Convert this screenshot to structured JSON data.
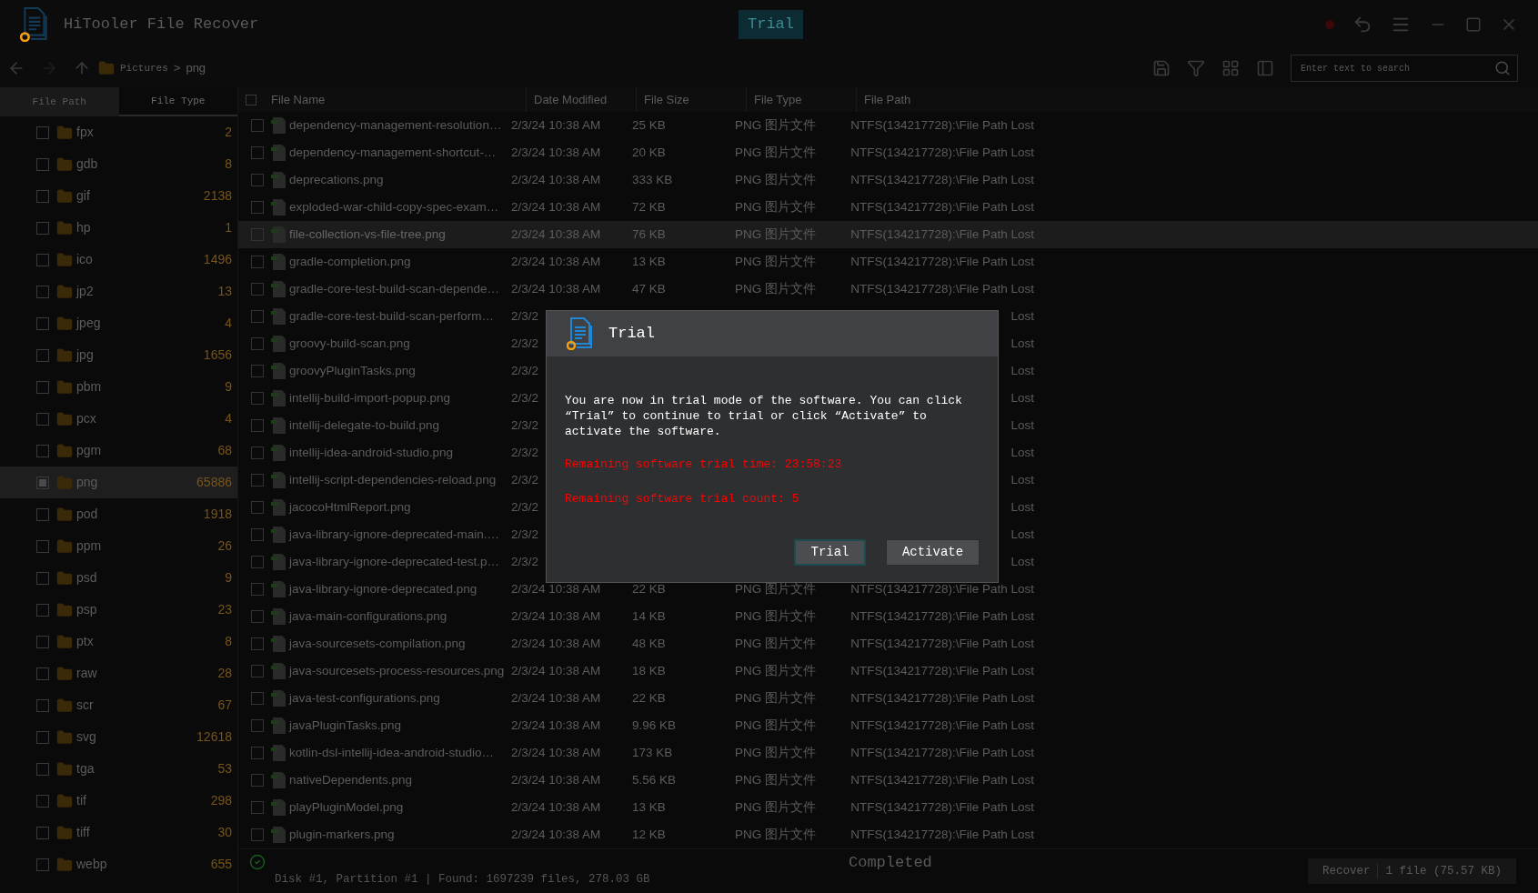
{
  "title_bar": {
    "app_name": "HiTooler File Recover",
    "badge": "Trial"
  },
  "breadcrumb": {
    "items": [
      "Pictures",
      "png"
    ],
    "separator": ">"
  },
  "search": {
    "placeholder": "Enter text to search"
  },
  "sidebar": {
    "tabs": [
      {
        "label": "File Path",
        "selected": false
      },
      {
        "label": "File Type",
        "selected": true
      }
    ],
    "items": [
      {
        "name": "fpx",
        "count": "2",
        "selected": false,
        "checked": false
      },
      {
        "name": "gdb",
        "count": "8",
        "selected": false,
        "checked": false
      },
      {
        "name": "gif",
        "count": "2138",
        "selected": false,
        "checked": false
      },
      {
        "name": "hp",
        "count": "1",
        "selected": false,
        "checked": false
      },
      {
        "name": "ico",
        "count": "1496",
        "selected": false,
        "checked": false
      },
      {
        "name": "jp2",
        "count": "13",
        "selected": false,
        "checked": false
      },
      {
        "name": "jpeg",
        "count": "4",
        "selected": false,
        "checked": false
      },
      {
        "name": "jpg",
        "count": "1656",
        "selected": false,
        "checked": false
      },
      {
        "name": "pbm",
        "count": "9",
        "selected": false,
        "checked": false
      },
      {
        "name": "pcx",
        "count": "4",
        "selected": false,
        "checked": false
      },
      {
        "name": "pgm",
        "count": "68",
        "selected": false,
        "checked": false
      },
      {
        "name": "png",
        "count": "65886",
        "selected": true,
        "checked": true
      },
      {
        "name": "pod",
        "count": "1918",
        "selected": false,
        "checked": false
      },
      {
        "name": "ppm",
        "count": "26",
        "selected": false,
        "checked": false
      },
      {
        "name": "psd",
        "count": "9",
        "selected": false,
        "checked": false
      },
      {
        "name": "psp",
        "count": "23",
        "selected": false,
        "checked": false
      },
      {
        "name": "ptx",
        "count": "8",
        "selected": false,
        "checked": false
      },
      {
        "name": "raw",
        "count": "28",
        "selected": false,
        "checked": false
      },
      {
        "name": "scr",
        "count": "67",
        "selected": false,
        "checked": false
      },
      {
        "name": "svg",
        "count": "12618",
        "selected": false,
        "checked": false
      },
      {
        "name": "tga",
        "count": "53",
        "selected": false,
        "checked": false
      },
      {
        "name": "tif",
        "count": "298",
        "selected": false,
        "checked": false
      },
      {
        "name": "tiff",
        "count": "30",
        "selected": false,
        "checked": false
      },
      {
        "name": "webp",
        "count": "655",
        "selected": false,
        "checked": false
      }
    ]
  },
  "table": {
    "all_checked": false,
    "columns": [
      "File Name",
      "Date Modified",
      "File Size",
      "File Type",
      "File Path"
    ],
    "rows": [
      {
        "name": "dependency-management-resolution…",
        "date": "2/3/24 10:38 AM",
        "size": "25 KB",
        "type": "PNG 图片文件",
        "path": "NTFS(134217728):\\File Path Lost",
        "selected": false,
        "checked": false
      },
      {
        "name": "dependency-management-shortcut-…",
        "date": "2/3/24 10:38 AM",
        "size": "20 KB",
        "type": "PNG 图片文件",
        "path": "NTFS(134217728):\\File Path Lost",
        "selected": false,
        "checked": false
      },
      {
        "name": "deprecations.png",
        "date": "2/3/24 10:38 AM",
        "size": "333 KB",
        "type": "PNG 图片文件",
        "path": "NTFS(134217728):\\File Path Lost",
        "selected": false,
        "checked": false
      },
      {
        "name": "exploded-war-child-copy-spec-exam…",
        "date": "2/3/24 10:38 AM",
        "size": "72 KB",
        "type": "PNG 图片文件",
        "path": "NTFS(134217728):\\File Path Lost",
        "selected": false,
        "checked": false
      },
      {
        "name": "file-collection-vs-file-tree.png",
        "date": "2/3/24 10:38 AM",
        "size": "76 KB",
        "type": "PNG 图片文件",
        "path": "NTFS(134217728):\\File Path Lost",
        "selected": true,
        "checked": false
      },
      {
        "name": "gradle-completion.png",
        "date": "2/3/24 10:38 AM",
        "size": "13 KB",
        "type": "PNG 图片文件",
        "path": "NTFS(134217728):\\File Path Lost",
        "selected": false,
        "checked": false
      },
      {
        "name": "gradle-core-test-build-scan-depende…",
        "date": "2/3/24 10:38 AM",
        "size": "47 KB",
        "type": "PNG 图片文件",
        "path": "NTFS(134217728):\\File Path Lost",
        "selected": false,
        "checked": false
      },
      {
        "name": "gradle-core-test-build-scan-perform…",
        "date": "2/3/2",
        "path": "Lost",
        "selected": false,
        "checked": false
      },
      {
        "name": "groovy-build-scan.png",
        "date": "2/3/2",
        "path": "Lost",
        "selected": false,
        "checked": false
      },
      {
        "name": "groovyPluginTasks.png",
        "date": "2/3/2",
        "path": "Lost",
        "selected": false,
        "checked": false
      },
      {
        "name": "intellij-build-import-popup.png",
        "date": "2/3/2",
        "path": "Lost",
        "selected": false,
        "checked": false
      },
      {
        "name": "intellij-delegate-to-build.png",
        "date": "2/3/2",
        "path": "Lost",
        "selected": false,
        "checked": false
      },
      {
        "name": "intellij-idea-android-studio.png",
        "date": "2/3/2",
        "path": "Lost",
        "selected": false,
        "checked": false
      },
      {
        "name": "intellij-script-dependencies-reload.png",
        "date": "2/3/2",
        "path": "Lost",
        "selected": false,
        "checked": false
      },
      {
        "name": "jacocoHtmlReport.png",
        "date": "2/3/2",
        "path": "Lost",
        "selected": false,
        "checked": false
      },
      {
        "name": "java-library-ignore-deprecated-main.…",
        "date": "2/3/2",
        "path": "Lost",
        "selected": false,
        "checked": false
      },
      {
        "name": "java-library-ignore-deprecated-test.p…",
        "date": "2/3/2",
        "path": "Lost",
        "selected": false,
        "checked": false
      },
      {
        "name": "java-library-ignore-deprecated.png",
        "date": "2/3/24 10:38 AM",
        "size": "22 KB",
        "type": "PNG 图片文件",
        "path": "NTFS(134217728):\\File Path Lost",
        "selected": false,
        "checked": false
      },
      {
        "name": "java-main-configurations.png",
        "date": "2/3/24 10:38 AM",
        "size": "14 KB",
        "type": "PNG 图片文件",
        "path": "NTFS(134217728):\\File Path Lost",
        "selected": false,
        "checked": false
      },
      {
        "name": "java-sourcesets-compilation.png",
        "date": "2/3/24 10:38 AM",
        "size": "48 KB",
        "type": "PNG 图片文件",
        "path": "NTFS(134217728):\\File Path Lost",
        "selected": false,
        "checked": false
      },
      {
        "name": "java-sourcesets-process-resources.png",
        "date": "2/3/24 10:38 AM",
        "size": "18 KB",
        "type": "PNG 图片文件",
        "path": "NTFS(134217728):\\File Path Lost",
        "selected": false,
        "checked": false
      },
      {
        "name": "java-test-configurations.png",
        "date": "2/3/24 10:38 AM",
        "size": "22 KB",
        "type": "PNG 图片文件",
        "path": "NTFS(134217728):\\File Path Lost",
        "selected": false,
        "checked": false
      },
      {
        "name": "javaPluginTasks.png",
        "date": "2/3/24 10:38 AM",
        "size": "9.96 KB",
        "type": "PNG 图片文件",
        "path": "NTFS(134217728):\\File Path Lost",
        "selected": false,
        "checked": false
      },
      {
        "name": "kotlin-dsl-intellij-idea-android-studio…",
        "date": "2/3/24 10:38 AM",
        "size": "173 KB",
        "type": "PNG 图片文件",
        "path": "NTFS(134217728):\\File Path Lost",
        "selected": false,
        "checked": false
      },
      {
        "name": "nativeDependents.png",
        "date": "2/3/24 10:38 AM",
        "size": "5.56 KB",
        "type": "PNG 图片文件",
        "path": "NTFS(134217728):\\File Path Lost",
        "selected": false,
        "checked": false
      },
      {
        "name": "playPluginModel.png",
        "date": "2/3/24 10:38 AM",
        "size": "13 KB",
        "type": "PNG 图片文件",
        "path": "NTFS(134217728):\\File Path Lost",
        "selected": false,
        "checked": false
      },
      {
        "name": "plugin-markers.png",
        "date": "2/3/24 10:38 AM",
        "size": "12 KB",
        "type": "PNG 图片文件",
        "path": "NTFS(134217728):\\File Path Lost",
        "selected": false,
        "checked": false
      }
    ]
  },
  "status_bar": {
    "summary": "Disk #1, Partition #1 | Found: 1697239 files, 278.03 GB",
    "state": "Completed",
    "recover": {
      "label": "Recover",
      "selection": "1 file (75.57 KB)"
    }
  },
  "dialog": {
    "title": "Trial",
    "message": "You are now in trial mode of the software. You can click “Trial” to continue to trial or click “Activate” to activate the software.",
    "notices": [
      "Remaining software trial time: 23:58:23",
      "Remaining software trial count: 5"
    ],
    "buttons": [
      {
        "label": "Trial",
        "focused": true
      },
      {
        "label": "Activate",
        "focused": false
      }
    ]
  }
}
